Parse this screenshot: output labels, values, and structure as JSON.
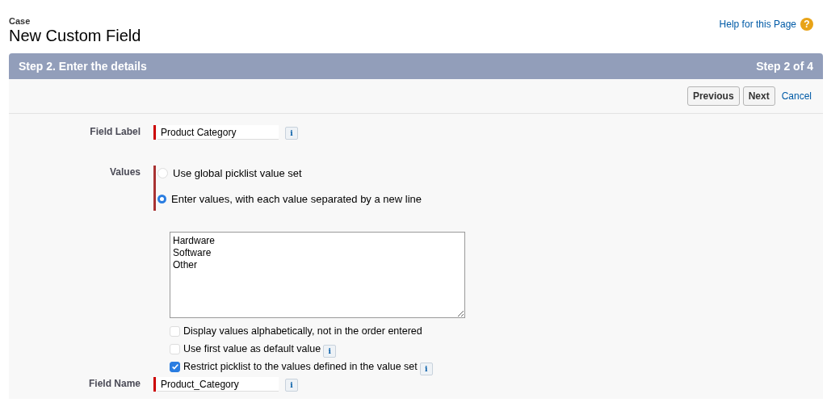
{
  "header": {
    "object": "Case",
    "title": "New Custom Field",
    "help_link": "Help for this Page",
    "help_icon": "?"
  },
  "step_bar": {
    "title": "Step 2. Enter the details",
    "progress": "Step 2 of 4"
  },
  "buttons": [
    {
      "label": "Previous",
      "kind": "button"
    },
    {
      "label": "Next",
      "kind": "button"
    },
    {
      "label": "Cancel",
      "kind": "link"
    }
  ],
  "field_label": {
    "label": "Field Label",
    "value": "Product Category",
    "info": "i"
  },
  "values": {
    "label": "Values",
    "options": [
      {
        "label": "Use global picklist value set",
        "selected": false
      },
      {
        "label": "Enter values, with each value separated by a new line",
        "selected": true
      }
    ],
    "entries": [
      "Hardware",
      "Software",
      "Other"
    ]
  },
  "checkboxes": [
    {
      "label": "Display values alphabetically, not in the order entered",
      "checked": false
    },
    {
      "label": "Use first value as default value",
      "checked": false,
      "info": "i"
    },
    {
      "label": "Restrict picklist to the values defined in the value set",
      "checked": true,
      "info": "i"
    }
  ],
  "field_name": {
    "label": "Field Name",
    "value": "Product_Category",
    "info": "i"
  }
}
